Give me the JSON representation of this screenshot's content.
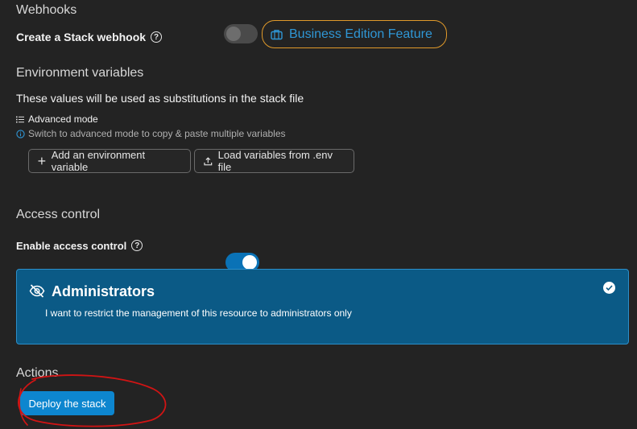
{
  "webhooks": {
    "title": "Webhooks",
    "create_label": "Create a Stack webhook",
    "toggle_state": "off",
    "badge_label": "Business Edition Feature"
  },
  "environment": {
    "title": "Environment variables",
    "description": "These values will be used as substitutions in the stack file",
    "advanced_mode_label": "Advanced mode",
    "advanced_hint": "Switch to advanced mode to copy & paste multiple variables",
    "add_button": "Add an environment variable",
    "load_button": "Load variables from .env file"
  },
  "access_control": {
    "title": "Access control",
    "enable_label": "Enable access control",
    "toggle_state": "on",
    "card": {
      "title": "Administrators",
      "description": "I want to restrict the management of this resource to administrators only",
      "selected": true
    }
  },
  "actions": {
    "title": "Actions",
    "deploy_button": "Deploy the stack"
  },
  "colors": {
    "background": "#232323",
    "accent": "#0d86cf",
    "badge_border": "#e19a2a",
    "card_bg": "#0b5a86",
    "annotation": "#d11414"
  },
  "icons": [
    "help-icon",
    "briefcase-icon",
    "list-icon",
    "info-icon",
    "plus-icon",
    "upload-icon",
    "eye-off-icon",
    "check-icon"
  ]
}
